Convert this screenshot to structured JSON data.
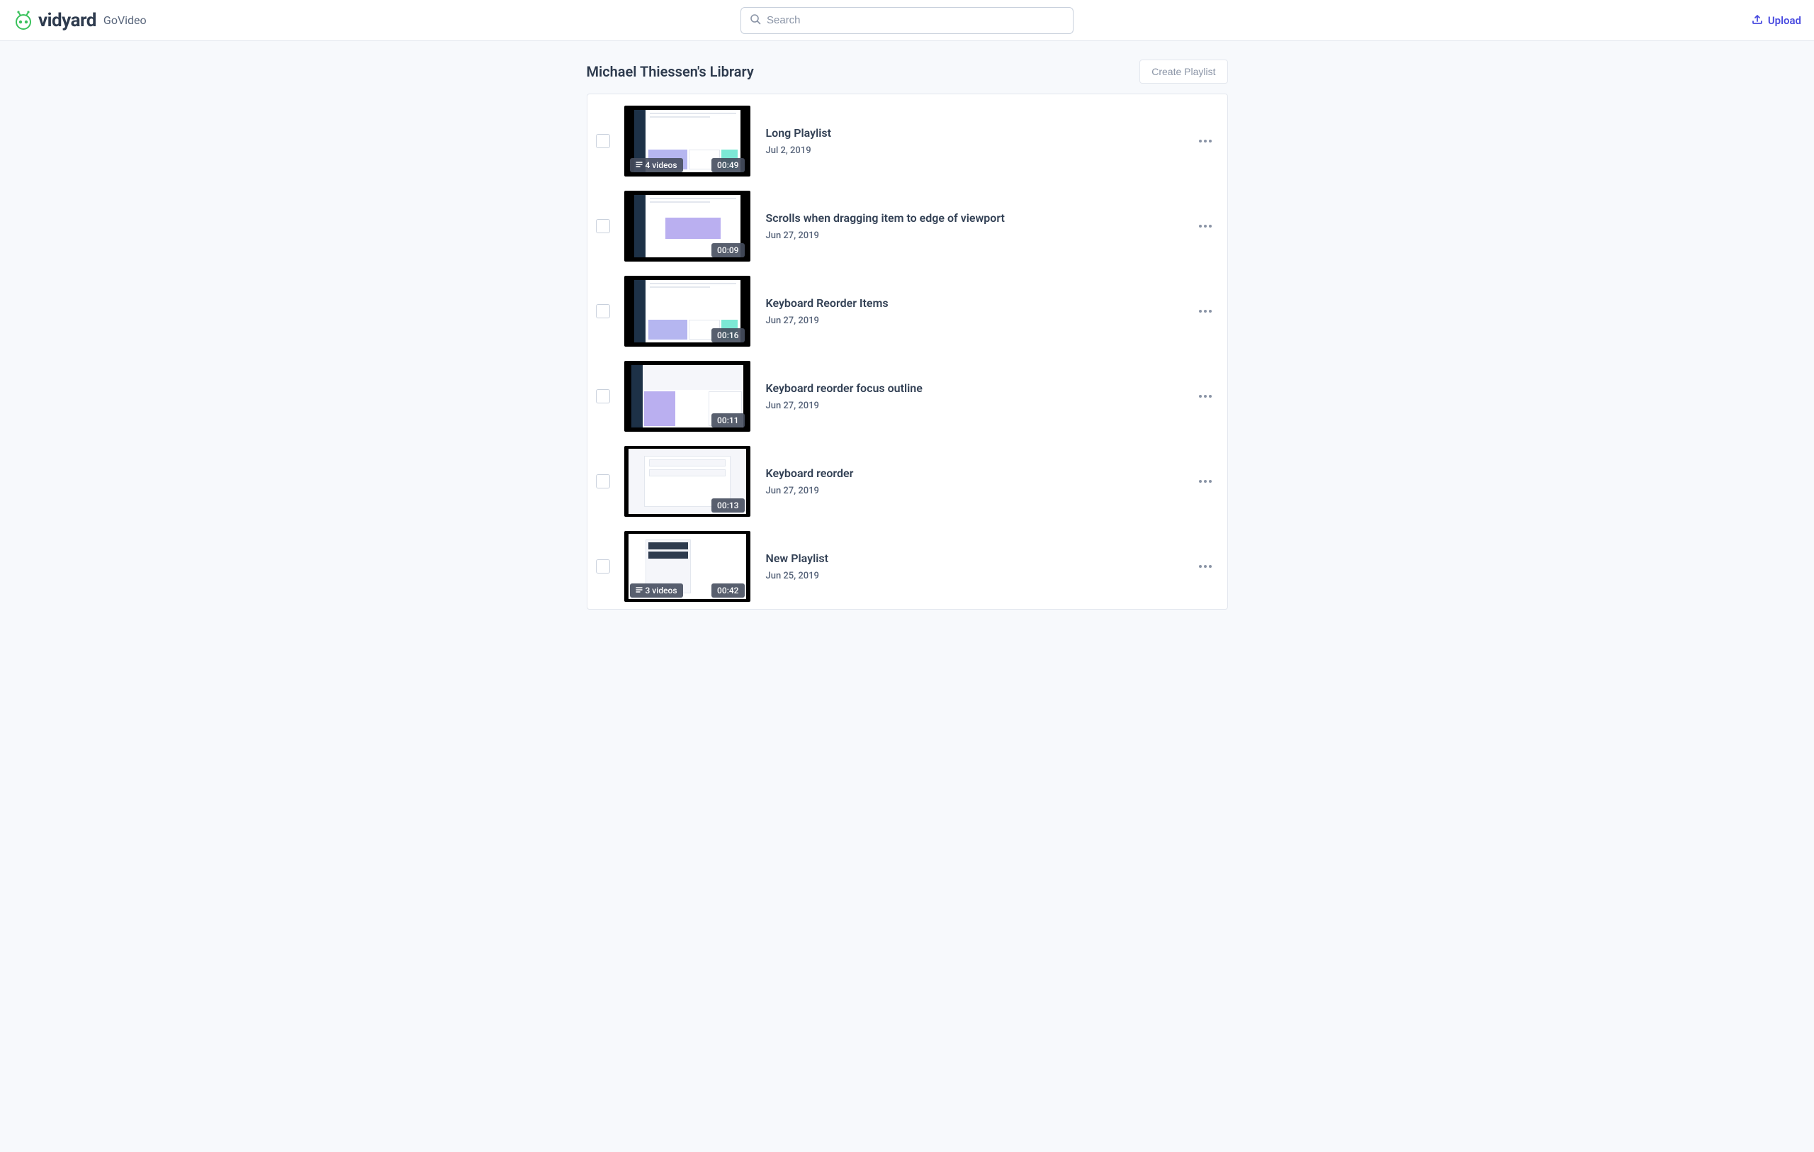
{
  "header": {
    "brand_main": "vidyard",
    "brand_sub": "GoVideo",
    "search_placeholder": "Search",
    "upload_label": "Upload"
  },
  "library": {
    "title": "Michael Thiessen's Library",
    "create_label": "Create Playlist"
  },
  "items": [
    {
      "title": "Long Playlist",
      "date": "Jul 2, 2019",
      "duration": "00:49",
      "videos_label": "4  videos",
      "has_videos_badge": true,
      "thumb_variant": "default"
    },
    {
      "title": "Scrolls when dragging item to edge of viewport",
      "date": "Jun 27, 2019",
      "duration": "00:09",
      "has_videos_badge": false,
      "thumb_variant": "center"
    },
    {
      "title": "Keyboard Reorder Items",
      "date": "Jun 27, 2019",
      "duration": "00:16",
      "has_videos_badge": false,
      "thumb_variant": "default"
    },
    {
      "title": "Keyboard reorder focus outline",
      "date": "Jun 27, 2019",
      "duration": "00:11",
      "has_videos_badge": false,
      "thumb_variant": "dark"
    },
    {
      "title": "Keyboard reorder",
      "date": "Jun 27, 2019",
      "duration": "00:13",
      "has_videos_badge": false,
      "thumb_variant": "list"
    },
    {
      "title": "New Playlist",
      "date": "Jun 25, 2019",
      "duration": "00:42",
      "videos_label": "3  videos",
      "has_videos_badge": true,
      "thumb_variant": "playlist"
    }
  ]
}
